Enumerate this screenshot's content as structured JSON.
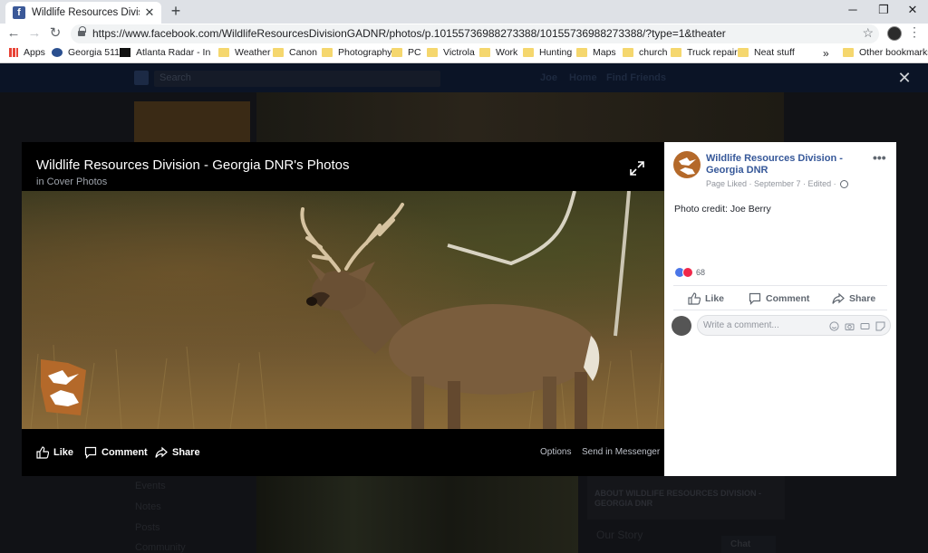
{
  "browser": {
    "tab_title": "Wildlife Resources Division - Geo",
    "url": "https://www.facebook.com/WildlifeResourcesDivisionGADNR/photos/p.10155736988273388/10155736988273388/?type=1&theater",
    "bookmarks": [
      {
        "label": "Apps",
        "icon": "apps-grid-icon"
      },
      {
        "label": "Georgia 511",
        "icon": "georgia-511-icon"
      },
      {
        "label": "Atlanta Radar - Inter",
        "icon": "radar-icon"
      },
      {
        "label": "Weather",
        "icon": "folder-icon"
      },
      {
        "label": "Canon",
        "icon": "folder-icon"
      },
      {
        "label": "Photography",
        "icon": "folder-icon"
      },
      {
        "label": "PC",
        "icon": "folder-icon"
      },
      {
        "label": "Victrola",
        "icon": "folder-icon"
      },
      {
        "label": "Work",
        "icon": "folder-icon"
      },
      {
        "label": "Hunting",
        "icon": "folder-icon"
      },
      {
        "label": "Maps",
        "icon": "folder-icon"
      },
      {
        "label": "church",
        "icon": "folder-icon"
      },
      {
        "label": "Truck repair",
        "icon": "folder-icon"
      },
      {
        "label": "Neat stuff",
        "icon": "folder-icon"
      }
    ],
    "overflow": "»",
    "other_bookmarks": "Other bookmarks"
  },
  "facebook_bg": {
    "search_placeholder": "Search",
    "nav": [
      "Joe",
      "Home",
      "Find Friends"
    ],
    "left_links": [
      "Events",
      "Notes",
      "Posts",
      "Community"
    ],
    "about_heading": "ABOUT WILDLIFE RESOURCES DIVISION - GEORGIA DNR",
    "our_story": "Our Story",
    "chat": "Chat"
  },
  "theater": {
    "album_title": "Wildlife Resources Division - Georgia DNR's Photos",
    "album_sub": "in Cover Photos",
    "actions": {
      "like": "Like",
      "comment": "Comment",
      "share": "Share"
    },
    "links": {
      "options": "Options",
      "messenger": "Send in Messenger"
    }
  },
  "post": {
    "page_name": "Wildlife Resources Division - Georgia DNR",
    "meta": "Page Liked · September 7 · Edited ·",
    "caption": "Photo credit: Joe Berry",
    "reaction_count": "68",
    "actions": {
      "like": "Like",
      "comment": "Comment",
      "share": "Share"
    },
    "comment_placeholder": "Write a comment..."
  },
  "colors": {
    "facebook_blue": "#365899",
    "like_blue": "#4a76e8",
    "love_red": "#f0284a",
    "logo_orange": "#b4692a"
  }
}
